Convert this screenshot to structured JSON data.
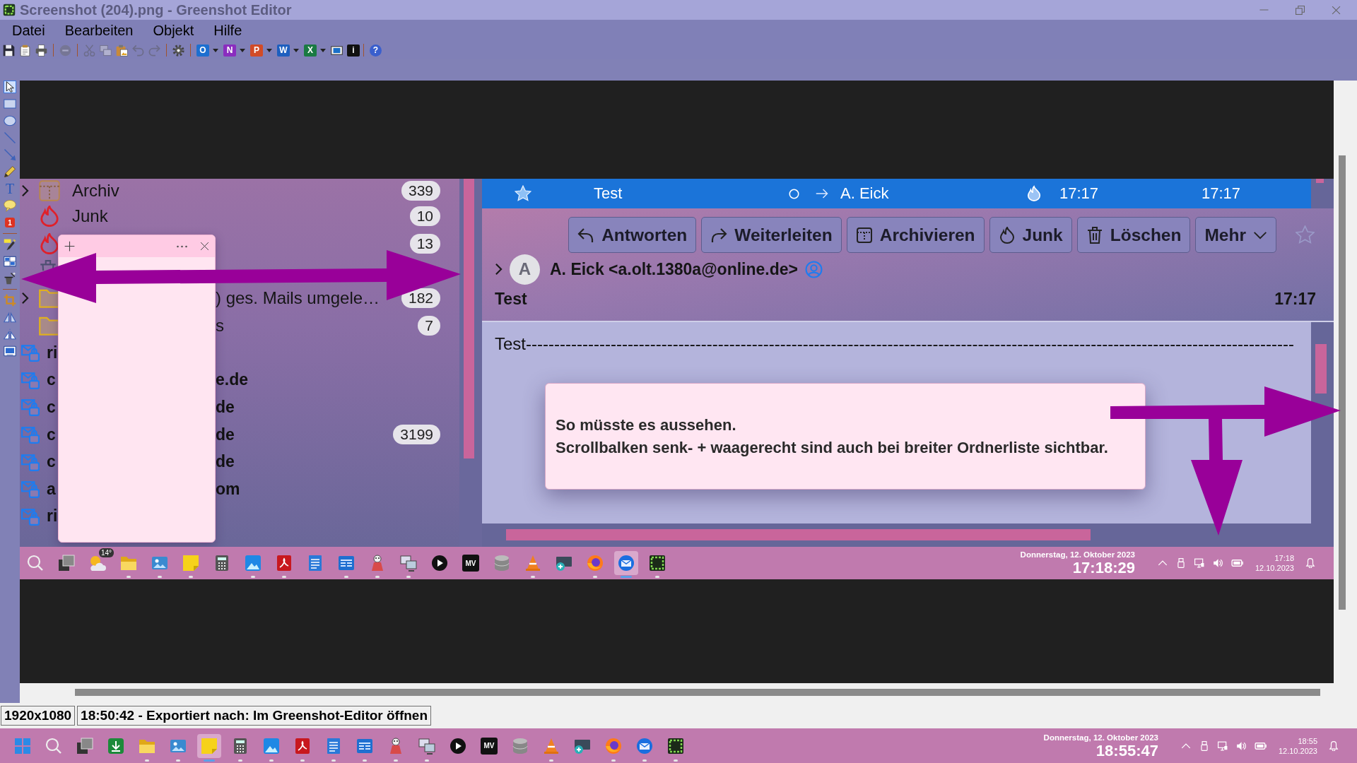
{
  "window": {
    "title": "Screenshot (204).png - Greenshot Editor"
  },
  "menu": [
    "Datei",
    "Bearbeiten",
    "Objekt",
    "Hilfe"
  ],
  "toolbar": [
    {
      "kind": "save",
      "disabled": false
    },
    {
      "kind": "clipboard",
      "disabled": false
    },
    {
      "kind": "print",
      "disabled": false
    },
    {
      "kind": "separator"
    },
    {
      "kind": "remove",
      "disabled": true
    },
    {
      "kind": "separator"
    },
    {
      "kind": "cut",
      "disabled": true
    },
    {
      "kind": "copy",
      "disabled": true
    },
    {
      "kind": "paste",
      "disabled": false
    },
    {
      "kind": "undo",
      "disabled": true
    },
    {
      "kind": "redo",
      "disabled": true
    },
    {
      "kind": "separator"
    },
    {
      "kind": "settings",
      "disabled": false
    },
    {
      "kind": "separator"
    },
    {
      "kind": "tile",
      "glyph": "O",
      "color": "#1c6fd0",
      "dropdown": true,
      "disabled": false
    },
    {
      "kind": "tile",
      "glyph": "N",
      "color": "#8a2dbf",
      "dropdown": true,
      "disabled": false
    },
    {
      "kind": "tile",
      "glyph": "P",
      "color": "#d24b26",
      "dropdown": true,
      "disabled": false
    },
    {
      "kind": "tile",
      "glyph": "W",
      "color": "#1d5fbf",
      "dropdown": true,
      "disabled": false
    },
    {
      "kind": "tile",
      "glyph": "X",
      "color": "#1a7a43",
      "dropdown": true,
      "disabled": false
    },
    {
      "kind": "film",
      "disabled": false
    },
    {
      "kind": "tile",
      "glyph": "i",
      "color": "#111111",
      "dropdown": false,
      "disabled": false
    },
    {
      "kind": "separator"
    },
    {
      "kind": "round",
      "glyph": "?",
      "color": "#3a5fcd",
      "dropdown": false,
      "disabled": false
    }
  ],
  "tools": [
    {
      "kind": "pointer",
      "selected": true
    },
    {
      "kind": "rectangle",
      "selected": false
    },
    {
      "kind": "ellipse",
      "selected": false
    },
    {
      "kind": "line",
      "selected": false
    },
    {
      "kind": "arrow",
      "selected": false
    },
    {
      "kind": "pencil",
      "selected": false
    },
    {
      "kind": "text",
      "glyph": "T",
      "selected": false
    },
    {
      "kind": "speech",
      "selected": false
    },
    {
      "kind": "counter",
      "glyph": "1",
      "selected": false
    },
    {
      "kind": "separator"
    },
    {
      "kind": "highlight",
      "selected": false
    },
    {
      "kind": "obfuscate",
      "selected": false
    },
    {
      "kind": "effects",
      "selected": false
    },
    {
      "kind": "separator"
    },
    {
      "kind": "crop",
      "selected": false
    },
    {
      "kind": "flip",
      "selected": false
    },
    {
      "kind": "mirror",
      "selected": false
    },
    {
      "kind": "image",
      "selected": false
    }
  ],
  "screenshot": {
    "folders": [
      {
        "kind": "archive",
        "expandable": true,
        "name": "Archiv",
        "count": "339"
      },
      {
        "kind": "junk",
        "expandable": false,
        "name": "Junk",
        "count": "10"
      },
      {
        "kind": "junk",
        "expandable": false,
        "count": "13"
      },
      {
        "kind": "trash",
        "expandable": false
      },
      {
        "kind": "folder",
        "expandable": true,
        "tail": ") ges. Mails umgele…",
        "count": "182"
      },
      {
        "kind": "folder",
        "expandable": false,
        "tail": "s",
        "count": "7"
      }
    ],
    "accounts": [
      {
        "name": "ri"
      },
      {
        "name": "c",
        "tail": "e.de"
      },
      {
        "name": "c",
        "tail": "de"
      },
      {
        "name": "c",
        "tail": "de",
        "count": "3199"
      },
      {
        "name": "c",
        "tail": "de"
      },
      {
        "name": "a",
        "tail": "om"
      },
      {
        "name": "ri"
      }
    ],
    "message_list": {
      "row": {
        "selected": true,
        "cells": [
          "Test",
          "A. Eick",
          "17:17",
          "17:17"
        ]
      }
    },
    "message": {
      "actions": [
        {
          "kind": "reply",
          "label": "Antworten"
        },
        {
          "kind": "forward",
          "label": "Weiterleiten"
        },
        {
          "kind": "archive",
          "label": "Archivieren"
        },
        {
          "kind": "junk",
          "label": "Junk"
        },
        {
          "kind": "delete",
          "label": "Löschen"
        },
        {
          "kind": "more",
          "label": "Mehr"
        }
      ],
      "avatar": "A",
      "from": "A. Eick <a.olt.1380a@online.de>",
      "subject": "Test",
      "time": "17:17",
      "body": "Test----------------------------------------------------------------------------------------------------------------------------------------",
      "popup": [
        "So müsste es aussehen.",
        "Scrollbalken senk- + waagerecht sind auch bei breiter Ordnerliste sichtbar."
      ]
    },
    "taskbar": {
      "apps": [
        {
          "kind": "search",
          "running": false,
          "selected": false
        },
        {
          "kind": "taskview",
          "running": false,
          "selected": false
        },
        {
          "kind": "weather",
          "glyph": "14°",
          "running": false,
          "selected": false
        },
        {
          "kind": "explorer",
          "running": true,
          "selected": false
        },
        {
          "kind": "photos",
          "running": true,
          "selected": false
        },
        {
          "kind": "sticky",
          "running": true,
          "selected": false
        },
        {
          "kind": "calculator",
          "running": false,
          "selected": false
        },
        {
          "kind": "paint",
          "running": true,
          "selected": false
        },
        {
          "kind": "pdf",
          "running": true,
          "selected": false
        },
        {
          "kind": "notepad",
          "running": false,
          "selected": false
        },
        {
          "kind": "app",
          "running": true,
          "selected": false
        },
        {
          "kind": "figure",
          "running": true,
          "selected": false
        },
        {
          "kind": "devices",
          "running": true,
          "selected": false
        },
        {
          "kind": "play",
          "running": false,
          "selected": false
        },
        {
          "kind": "video",
          "glyph": "MV",
          "running": false,
          "selected": false
        },
        {
          "kind": "database",
          "running": false,
          "selected": false
        },
        {
          "kind": "cone",
          "running": true,
          "selected": false
        },
        {
          "kind": "screenplus",
          "running": false,
          "selected": false
        },
        {
          "kind": "browser",
          "running": true,
          "selected": false
        },
        {
          "kind": "mail",
          "running": true,
          "selected": true
        },
        {
          "kind": "capture",
          "running": true,
          "selected": false
        }
      ],
      "date": "Donnerstag, 12. Oktober 2023",
      "time": "17:18:29",
      "clock_time": "17:18",
      "clock_date": "12.10.2023"
    }
  },
  "status_bar": {
    "size": "1920x1080",
    "message": "18:50:42 - Exportiert nach: Im Greenshot-Editor öffnen"
  },
  "taskbar": {
    "apps": [
      {
        "kind": "windows",
        "running": false,
        "selected": false
      },
      {
        "kind": "search",
        "running": false,
        "selected": false
      },
      {
        "kind": "taskview",
        "running": false,
        "selected": false
      },
      {
        "kind": "download",
        "running": false,
        "selected": false
      },
      {
        "kind": "explorer",
        "running": true,
        "selected": false
      },
      {
        "kind": "photos",
        "running": true,
        "selected": false
      },
      {
        "kind": "sticky",
        "running": true,
        "selected": true
      },
      {
        "kind": "calculator",
        "running": true,
        "selected": false
      },
      {
        "kind": "paint",
        "running": true,
        "selected": false
      },
      {
        "kind": "pdf",
        "running": true,
        "selected": false
      },
      {
        "kind": "notepad",
        "running": true,
        "selected": false
      },
      {
        "kind": "app",
        "running": true,
        "selected": false
      },
      {
        "kind": "figure",
        "running": true,
        "selected": false
      },
      {
        "kind": "devices",
        "running": true,
        "selected": false
      },
      {
        "kind": "play",
        "running": false,
        "selected": false
      },
      {
        "kind": "video",
        "glyph": "MV",
        "running": false,
        "selected": false
      },
      {
        "kind": "database",
        "running": false,
        "selected": false
      },
      {
        "kind": "cone",
        "running": true,
        "selected": false
      },
      {
        "kind": "screenplus",
        "running": false,
        "selected": false
      },
      {
        "kind": "browser",
        "running": true,
        "selected": false
      },
      {
        "kind": "mail",
        "running": true,
        "selected": false
      },
      {
        "kind": "capture",
        "running": true,
        "selected": false
      }
    ],
    "date": "Donnerstag, 12. Oktober 2023",
    "time": "18:55:47",
    "clock_time": "18:55",
    "clock_date": "12.10.2023"
  }
}
